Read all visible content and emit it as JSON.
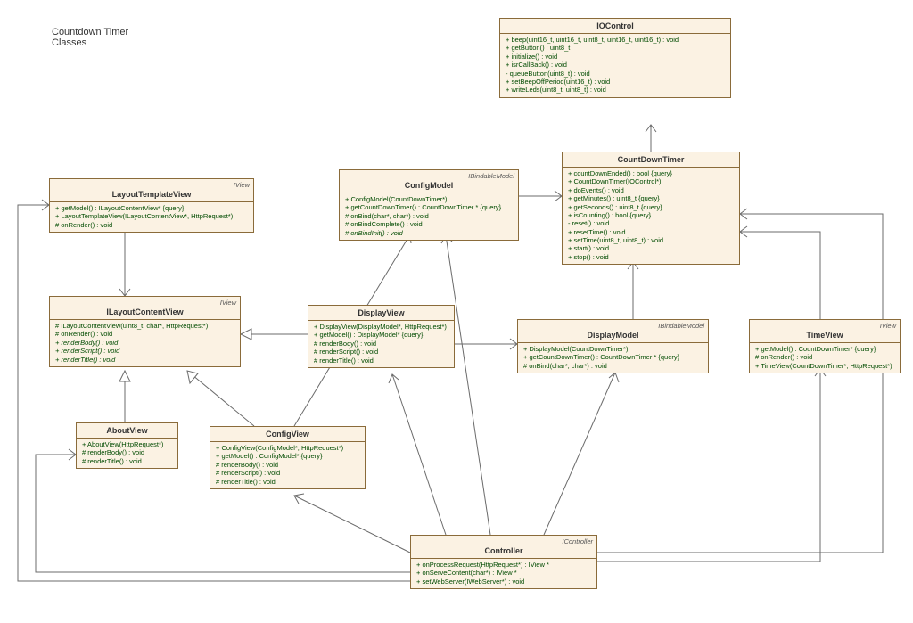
{
  "title": {
    "line1": "Countdown Timer",
    "line2": "Classes"
  },
  "stereotypes": {
    "iview": "IView",
    "ibindable": "IBindableModel",
    "icontroller": "IController"
  },
  "classes": {
    "iocontrol": {
      "name": "IOControl",
      "members": [
        "+   beep(uint16_t, uint16_t, uint8_t, uint16_t, uint16_t) : void",
        "+   getButton() : uint8_t",
        "+   initialize() : void",
        "+   isrCallBack() : void",
        "-   queueButton(uint8_t) : void",
        "+   setBeepOffPeriod(uint16_t) : void",
        "+   writeLeds(uint8_t, uint8_t) : void"
      ]
    },
    "countdowntimer": {
      "name": "CountDownTimer",
      "members": [
        "+   countDownEnded() : bool {query}",
        "+   CountDownTimer(IOControl*)",
        "+   doEvents() : void",
        "+   getMinutes() : uint8_t {query}",
        "+   getSeconds() : uint8_t {query}",
        "+   isCounting() : bool {query}",
        "-   reset() : void",
        "+   resetTime() : void",
        "+   setTime(uint8_t, uint8_t) : void",
        "+   start() : void",
        "+   stop() : void"
      ]
    },
    "layouttemplateview": {
      "name": "LayoutTemplateView",
      "members": [
        "+   getModel() : ILayoutContentView* {query}",
        "+   LayoutTemplateView(ILayoutContentView*, HttpRequest*)",
        "#   onRender() : void"
      ]
    },
    "configmodel": {
      "name": "ConfigModel",
      "members": [
        "+   ConfigModel(CountDownTimer*)",
        "+   getCountDownTimer() : CountDownTimer * {query}",
        "#   onBind(char*, char*) : void",
        "#   onBindComplete() : void",
        "#   onBindInit() : void"
      ],
      "italics": [
        4
      ]
    },
    "ilayoutcontentview": {
      "name": "ILayoutContentView",
      "members": [
        "#   ILayoutContentView(uint8_t, char*, HttpRequest*)",
        "#   onRender() : void",
        "+   renderBody() : void",
        "+   renderScript() : void",
        "+   renderTitle() : void"
      ],
      "italics": [
        2,
        3,
        4
      ]
    },
    "displayview": {
      "name": "DisplayView",
      "members": [
        "+   DisplayView(DisplayModel*, HttpRequest*)",
        "+   getModel() : DisplayModel* {query}",
        "#   renderBody() : void",
        "#   renderScript() : void",
        "#   renderTitle() : void"
      ]
    },
    "displaymodel": {
      "name": "DisplayModel",
      "members": [
        "+   DisplayModel(CountDownTimer*)",
        "+   getCountDownTimer() : CountDownTimer * {query}",
        "#   onBind(char*, char*) : void"
      ]
    },
    "timeview": {
      "name": "TimeView",
      "members": [
        "+   getModel() : CountDownTimer* {query}",
        "#   onRender() : void",
        "+   TimeView(CountDownTimer*, HttpRequest*)"
      ]
    },
    "aboutview": {
      "name": "AboutView",
      "members": [
        "+   AboutView(HttpRequest*)",
        "#   renderBody() : void",
        "#   renderTitle() : void"
      ]
    },
    "configview": {
      "name": "ConfigView",
      "members": [
        "+   ConfigView(ConfigModel*, HttpRequest*)",
        "+   getModel() : ConfigModel* {query}",
        "#   renderBody() : void",
        "#   renderScript() : void",
        "#   renderTitle() : void"
      ]
    },
    "controller": {
      "name": "Controller",
      "members": [
        "+   onProcessRequest(HttpRequest*) : IView *",
        "+   onServeContent(char*) : IView *",
        "+   setWebServer(IWebServer*) : void"
      ]
    }
  }
}
